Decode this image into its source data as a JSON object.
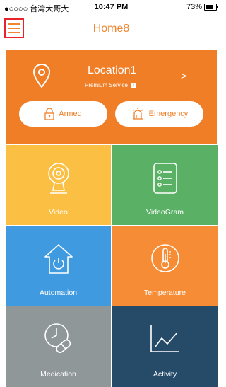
{
  "status_bar": {
    "carrier": "●○○○○ 台湾大哥大",
    "time": "10:47 PM",
    "battery": "73%",
    "battery_level": 0.73
  },
  "nav": {
    "title": "Home8"
  },
  "location": {
    "name": "Location1",
    "service": "Premium Service",
    "chevron": ">"
  },
  "buttons": {
    "armed": "Armed",
    "emergency": "Emergency"
  },
  "tiles": [
    {
      "label": "Video",
      "color": "#fbbf43"
    },
    {
      "label": "VideoGram",
      "color": "#5ab166"
    },
    {
      "label": "Automation",
      "color": "#3f9ae0"
    },
    {
      "label": "Temperature",
      "color": "#f78c36"
    },
    {
      "label": "Medication",
      "color": "#8f9799"
    },
    {
      "label": "Activity",
      "color": "#264b69"
    }
  ],
  "colors": {
    "accent": "#f07e27",
    "menu_highlight": "#e8242a"
  }
}
